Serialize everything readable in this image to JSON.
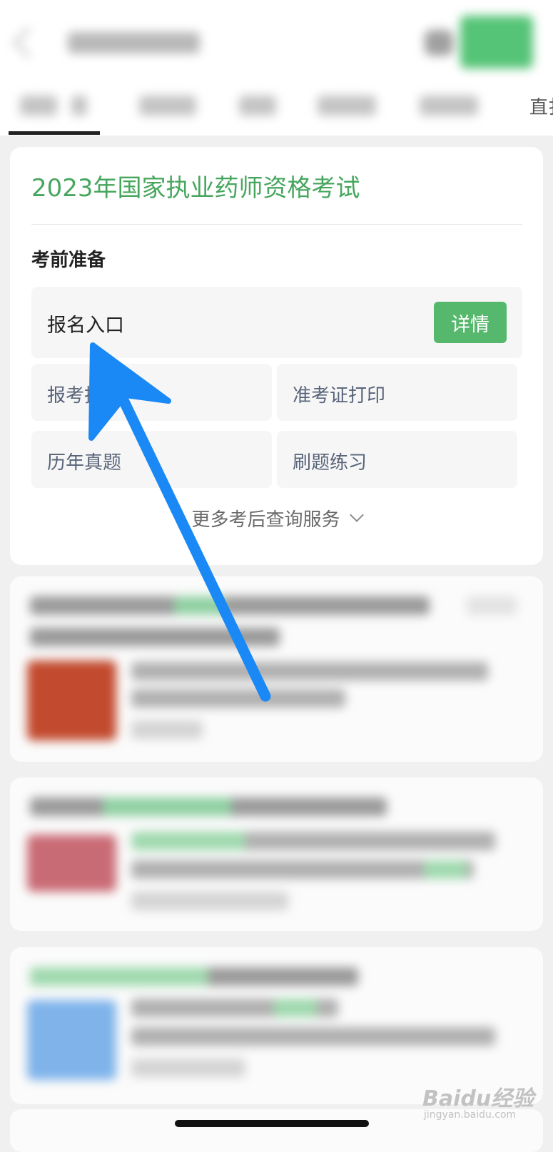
{
  "header": {
    "edge_tab_text": "直扌"
  },
  "card": {
    "title": "2023年国家执业药师资格考试",
    "section_title": "考前准备",
    "entry": {
      "label": "报名入口",
      "button_label": "详情"
    },
    "grid": [
      "报考指南",
      "准考证打印",
      "历年真题",
      "刷题练习"
    ],
    "more_label": "更多考后查询服务"
  },
  "watermark": {
    "main": "Baidu经验",
    "sub": "jingyan.baidu.com"
  },
  "colors": {
    "title_green": "#47a65e",
    "button_green": "#55b86c",
    "arrow_blue": "#1a88f5"
  }
}
